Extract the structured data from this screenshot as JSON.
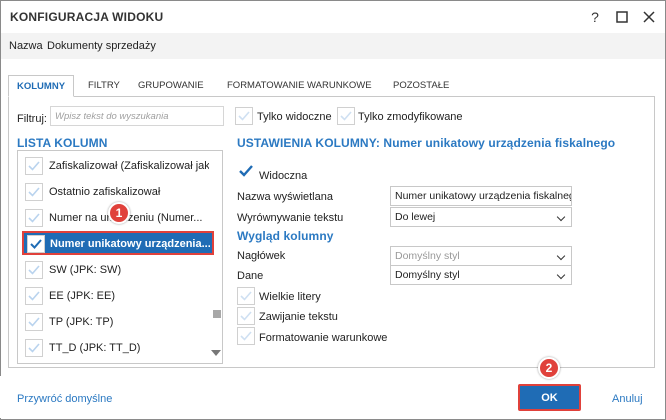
{
  "window": {
    "title": "KONFIGURACJA WIDOKU",
    "help": "?",
    "maximize": "☐",
    "close": "✕"
  },
  "nazwa": {
    "label": "Nazwa:",
    "value": "Dokumenty sprzedaży"
  },
  "tabs": [
    {
      "label": "KOLUMNY",
      "active": true
    },
    {
      "label": "FILTRY"
    },
    {
      "label": "GRUPOWANIE"
    },
    {
      "label": "FORMATOWANIE WARUNKOWE"
    },
    {
      "label": "POZOSTAŁE"
    }
  ],
  "filter": {
    "label": "Filtruj:",
    "placeholder": "Wpisz tekst do wyszukania",
    "only_visible": "Tylko widoczne",
    "only_modified": "Tylko zmodyfikowane"
  },
  "column_list": {
    "title": "LISTA KOLUMN",
    "items": [
      {
        "label": "Zafiskalizował (Zafiskalizował jako...",
        "checked": true
      },
      {
        "label": "Ostatnio zafiskalizował",
        "checked": true
      },
      {
        "label": "Numer na urządzeniu (Numer...",
        "checked": true
      },
      {
        "label": "Numer unikatowy urządzenia...",
        "checked": true,
        "selected": true
      },
      {
        "label": "SW (JPK: SW)",
        "checked": true
      },
      {
        "label": "EE (JPK: EE)",
        "checked": true
      },
      {
        "label": "TP (JPK: TP)",
        "checked": true
      },
      {
        "label": "TT_D (JPK: TT_D)",
        "checked": true
      }
    ]
  },
  "settings": {
    "title": "USTAWIENIA KOLUMNY: Numer unikatowy urządzenia fiskalnego",
    "visible_label": "Widoczna",
    "display_name_label": "Nazwa wyświetlana",
    "display_name_value": "Numer unikatowy urządzenia fiskalnego",
    "align_label": "Wyrównywanie tekstu",
    "align_value": "Do lewej",
    "appearance_title": "Wygląd kolumny",
    "header_label": "Nagłówek",
    "header_value": "Domyślny styl",
    "data_label": "Dane",
    "data_value": "Domyślny styl",
    "bold_label": "Wielkie litery",
    "wrap_label": "Zawijanie tekstu",
    "cond_format_label": "Formatowanie warunkowe"
  },
  "badges": {
    "one": "1",
    "two": "2"
  },
  "footer": {
    "restore": "Przywróć domyślne",
    "ok": "OK",
    "cancel": "Anuluj"
  },
  "colors": {
    "accent": "#1f6cb5",
    "highlight": "#e0413b",
    "link": "#2b79c2"
  }
}
